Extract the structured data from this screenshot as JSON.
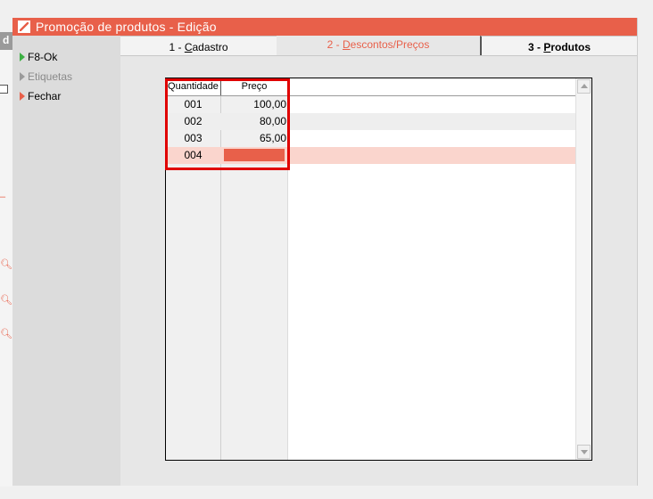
{
  "window": {
    "title": "Promoção de produtos - Edição",
    "background_window_letter": "d"
  },
  "commands": [
    {
      "label": "F8-Ok",
      "enabled": true
    },
    {
      "label": "Etiquetas",
      "enabled": false
    },
    {
      "label": "Fechar",
      "enabled": true
    }
  ],
  "tabs": [
    {
      "number": "1 - ",
      "hotkey": "C",
      "rest": "adastro",
      "active": false
    },
    {
      "number": "2 - ",
      "hotkey": "D",
      "rest": "escontos/Preços",
      "active": true
    },
    {
      "number": "3 - ",
      "hotkey": "P",
      "rest": "rodutos",
      "active": false
    }
  ],
  "grid": {
    "columns": [
      "Quantidade",
      "Preço"
    ],
    "rows": [
      {
        "qtd": "001",
        "preco": "100,00"
      },
      {
        "qtd": "002",
        "preco": "80,00"
      },
      {
        "qtd": "003",
        "preco": "65,00"
      },
      {
        "qtd": "004",
        "preco": ""
      }
    ],
    "selected_row": 3
  },
  "colors": {
    "accent": "#e8604a",
    "highlight_box": "#e00000",
    "selected_row": "#fad5cd",
    "ok_arrow": "#3cb043"
  },
  "icons": {
    "search": "search-icon",
    "logo": "app-logo-icon"
  }
}
